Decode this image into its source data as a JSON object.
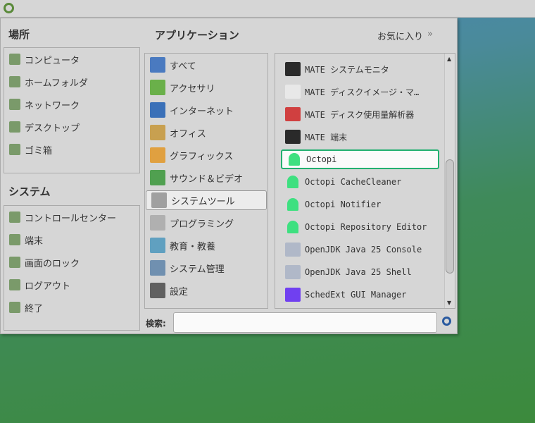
{
  "places": {
    "title": "場所",
    "items": [
      {
        "label": "コンピュータ",
        "icon": "computer-icon"
      },
      {
        "label": "ホームフォルダ",
        "icon": "home-folder-icon"
      },
      {
        "label": "ネットワーク",
        "icon": "network-icon"
      },
      {
        "label": "デスクトップ",
        "icon": "desktop-folder-icon"
      },
      {
        "label": "ゴミ箱",
        "icon": "trash-icon"
      }
    ]
  },
  "system": {
    "title": "システム",
    "items": [
      {
        "label": "コントロールセンター",
        "icon": "control-center-icon"
      },
      {
        "label": "端末",
        "icon": "terminal-icon"
      },
      {
        "label": "画面のロック",
        "icon": "lock-screen-icon"
      },
      {
        "label": "ログアウト",
        "icon": "logout-icon"
      },
      {
        "label": "終了",
        "icon": "shutdown-icon"
      }
    ]
  },
  "applications": {
    "title": "アプリケーション",
    "favorites": "お気に入り"
  },
  "categories": [
    {
      "label": "すべて",
      "color": "#4a7ac0"
    },
    {
      "label": "アクセサリ",
      "color": "#6ab04a"
    },
    {
      "label": "インターネット",
      "color": "#3a70b8"
    },
    {
      "label": "オフィス",
      "color": "#c8a050"
    },
    {
      "label": "グラフィックス",
      "color": "#e0a040"
    },
    {
      "label": "サウンド＆ビデオ",
      "color": "#50a050"
    },
    {
      "label": "システムツール",
      "color": "#a0a0a0",
      "selected": true
    },
    {
      "label": "プログラミング",
      "color": "#b0b0b0"
    },
    {
      "label": "教育・教養",
      "color": "#60a0c0"
    },
    {
      "label": "システム管理",
      "color": "#7090b0"
    },
    {
      "label": "設定",
      "color": "#606060"
    }
  ],
  "apps": [
    {
      "label": "MATE システムモニタ",
      "color": "#2a2a2a"
    },
    {
      "label": "MATE ディスクイメージ・マ…",
      "color": "#e8e8e8"
    },
    {
      "label": "MATE ディスク使用量解析器",
      "color": "#d04040"
    },
    {
      "label": "MATE 端末",
      "color": "#2a2a2a"
    },
    {
      "label": "Octopi",
      "ghost": true,
      "selected": true
    },
    {
      "label": "Octopi CacheCleaner",
      "ghost": true
    },
    {
      "label": "Octopi Notifier",
      "ghost": true
    },
    {
      "label": "Octopi Repository Editor",
      "ghost": true
    },
    {
      "label": "OpenJDK Java 25 Console",
      "color": "#b0b8c8"
    },
    {
      "label": "OpenJDK Java 25 Shell",
      "color": "#b0b8c8"
    },
    {
      "label": "SchedExt GUI Manager",
      "color": "#7040f0"
    }
  ],
  "search": {
    "label": "検索:",
    "value": ""
  }
}
